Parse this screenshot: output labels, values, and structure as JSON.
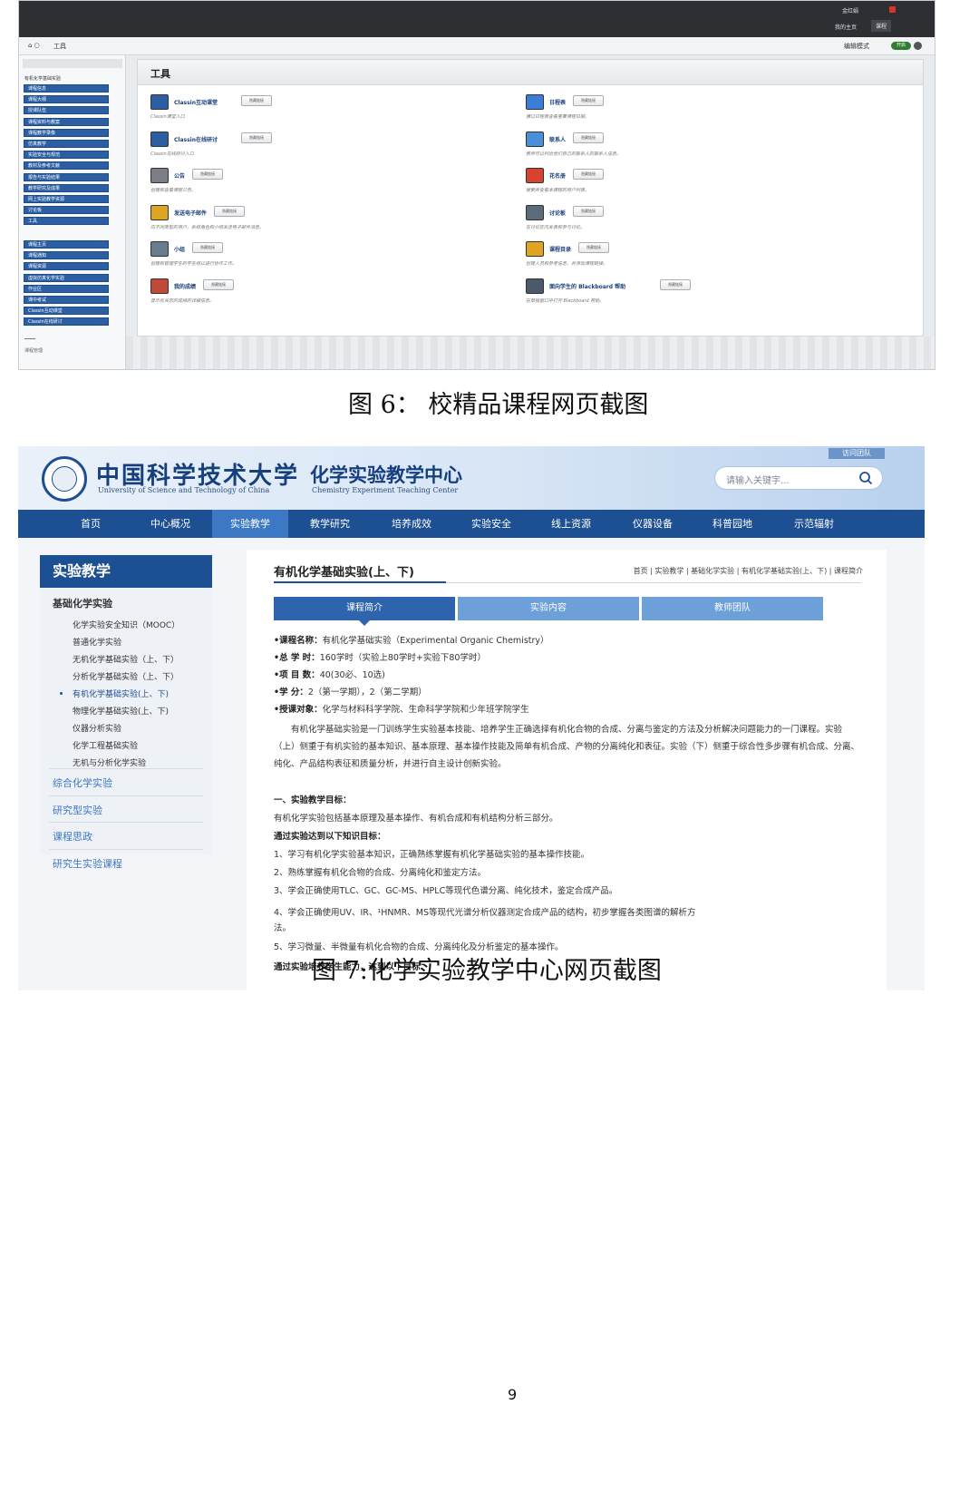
{
  "fig6": {
    "topbar": {
      "user_label": "金红娟",
      "tab_home": "我的主页",
      "tab_courses": "课程"
    },
    "breadcrumb": {
      "root": "工具",
      "edit_mode": "编辑模式",
      "toggle": "开启"
    },
    "sidebar": {
      "title": "有机化学基础实验",
      "items_group1": [
        "课程信息",
        "课程大纲",
        "授课队伍",
        "课程资料与教案",
        "课程教学录像",
        "仿真教学",
        "实验安全与规范",
        "教材及参考文献",
        "报告与实验结果",
        "教学研究及成果",
        "网上实验教学资源",
        "讨论板",
        "工具"
      ],
      "items_group2": [
        "课程主页",
        "课程通知",
        "课程资源",
        "虚拟仿真化学实验",
        "作业区",
        "课中考试",
        "Classin互动课堂",
        "Classin在线研讨"
      ],
      "footer": "课程管理"
    },
    "main_title": "工具",
    "button_label": "隐藏链接",
    "tools": [
      {
        "name": "Classin互动课堂",
        "desc": "Classin课堂入口"
      },
      {
        "name": "日程表",
        "desc": "通过日程表查看重要课程日期。"
      },
      {
        "name": "Classin在线研讨",
        "desc": "Classin在线研讨入口"
      },
      {
        "name": "联系人",
        "desc": "教师可以列出他们自己的联系人的联系人信息。"
      },
      {
        "name": "公告",
        "desc": "创建和查看课程公告。"
      },
      {
        "name": "花名册",
        "desc": "搜索并查看本课程的用户列表。"
      },
      {
        "name": "发送电子邮件",
        "desc": "向不同类型的用户、系统角色和小组发送电子邮件消息。"
      },
      {
        "name": "讨论板",
        "desc": "在讨论区内发表和参与讨论。"
      },
      {
        "name": "小组",
        "desc": "创建和管理学生的学生组以进行协作工作。"
      },
      {
        "name": "课程目录",
        "desc": "创建人员和参考信息，并添加课程链接。"
      },
      {
        "name": "我的成绩",
        "desc": "显示有关您的成绩的详细信息。"
      },
      {
        "name": "面向学生的 Blackboard 帮助",
        "desc": "在单独窗口中打开 Blackboard 帮助。"
      }
    ]
  },
  "caption6": "图 6：  校精品课程网页截图",
  "fig7": {
    "visit_label": "访问团队",
    "uni_name": "中国科学技术大学",
    "uni_en": "University of Science and Technology of China",
    "center_name": "化学实验教学中心",
    "center_en": "Chemistry Experiment Teaching Center",
    "search_placeholder": "请输入关键字...",
    "nav": [
      "首页",
      "中心概况",
      "实验教学",
      "教学研究",
      "培养成效",
      "实验安全",
      "线上资源",
      "仪器设备",
      "科普园地",
      "示范辐射"
    ],
    "left_head": "实验教学",
    "left_sub": "基础化学实验",
    "left_items": [
      "化学实验安全知识（MOOC）",
      "普通化学实验",
      "无机化学基础实验（上、下）",
      "分析化学基础实验（上、下）",
      "有机化学基础实验(上、下)",
      "物理化学基础实验(上、下)",
      "仪器分析实验",
      "化学工程基础实验",
      "无机与分析化学实验"
    ],
    "left_sections": [
      "综合化学实验",
      "研究型实验",
      "课程思政",
      "研究生实验课程"
    ],
    "page_title": "有机化学基础实验(上、下)",
    "breadcrumb": "首页  |  实验教学  |  基础化学实验  |  有机化学基础实验(上、下)  |  课程简介",
    "tabs": [
      "课程简介",
      "实验内容",
      "教师团队"
    ],
    "info": [
      {
        "label": "•课程名称：",
        "value": "有机化学基础实验（Experimental Organic Chemistry）"
      },
      {
        "label": "•总  学  时：",
        "value": "160学时（实验上80学时+实验下80学时）"
      },
      {
        "label": "•项  目  数：",
        "value": "40(30必、10选)"
      },
      {
        "label": "•学        分：",
        "value": "2（第一学期），2（第二学期）"
      },
      {
        "label": "•授课对象：",
        "value": "化学与材料科学学院、生命科学学院和少年班学院学生"
      }
    ],
    "intro": "有机化学基础实验是一门训练学生实验基本技能、培养学生正确选择有机化合物的合成、分离与鉴定的方法及分析解决问题能力的一门课程。实验（上）侧重于有机实验的基本知识、基本原理、基本操作技能及简单有机合成、产物的分离纯化和表征。实验（下）侧重于综合性多步骤有机合成、分离、纯化、产品结构表征和质量分析，并进行自主设计创新实验。",
    "goal_heading": "一、实验教学目标：",
    "goal_text": "有机化学实验包括基本原理及基本操作、有机合成和有机结构分析三部分。",
    "knowledge_heading": "通过实验达到以下知识目标：",
    "knowledge_items": [
      "1、学习有机化学实验基本知识，正确熟练掌握有机化学基础实验的基本操作技能。",
      "2、熟练掌握有机化合物的合成、分离纯化和鉴定方法。",
      "3、学会正确使用TLC、GC、GC-MS、HPLC等现代色谱分离、纯化技术，鉴定合成产品。",
      "4、学会正确使用UV、IR、¹HNMR、MS等现代光谱分析仪器测定合成产品的结构，初步掌握各类图谱的解析方",
      "法。",
      "5、学习微量、半微量有机化合物的合成、分离纯化及分析鉴定的基本操作。"
    ],
    "ability_heading": "通过实验培养学生能力，达到以下目标："
  },
  "caption7": "图 7:化学实验教学中心网页截图",
  "page_number": "9"
}
